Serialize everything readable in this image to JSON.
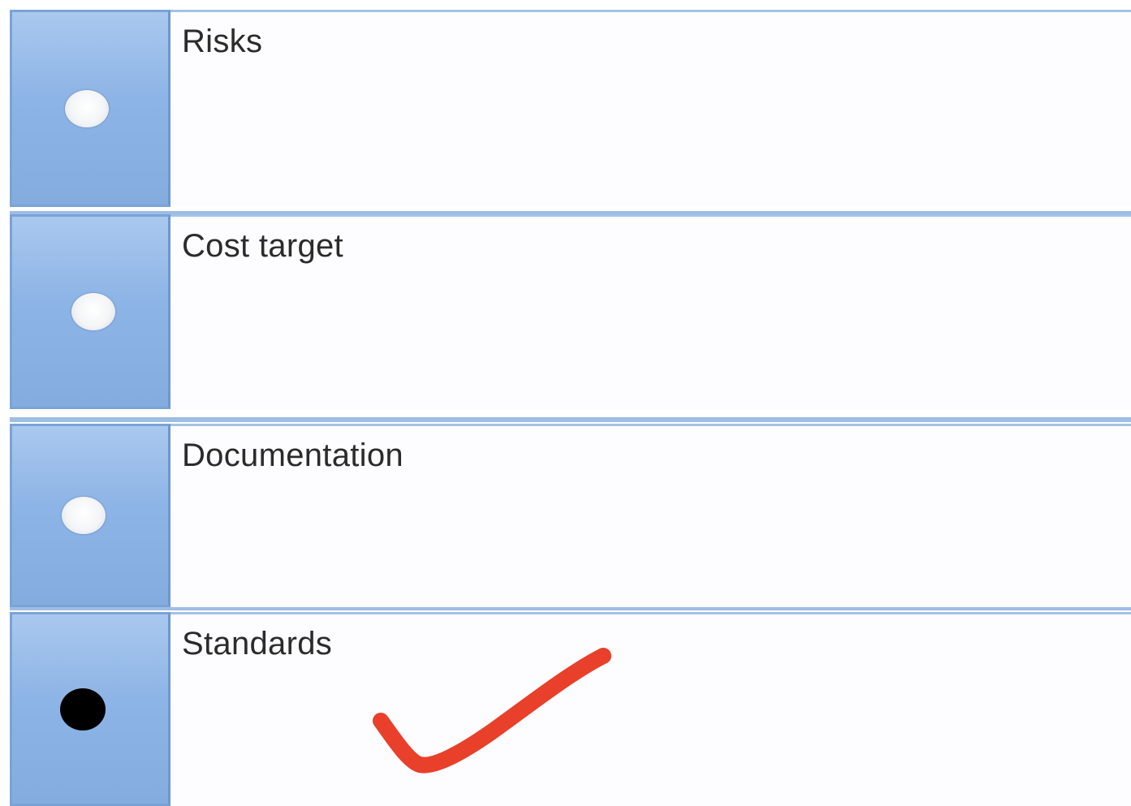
{
  "options": [
    {
      "label": "Risks",
      "selected": false
    },
    {
      "label": "Cost target",
      "selected": false
    },
    {
      "label": "Documentation",
      "selected": false
    },
    {
      "label": "Standards",
      "selected": true
    }
  ],
  "annotation": {
    "type": "checkmark",
    "color": "#e8402a",
    "marks_option": "Standards"
  },
  "colors": {
    "selector_fill": "#8db4e6",
    "border_blue": "#7aa3d8",
    "radio_unselected": "#f4f5f7",
    "radio_selected": "#000000"
  }
}
